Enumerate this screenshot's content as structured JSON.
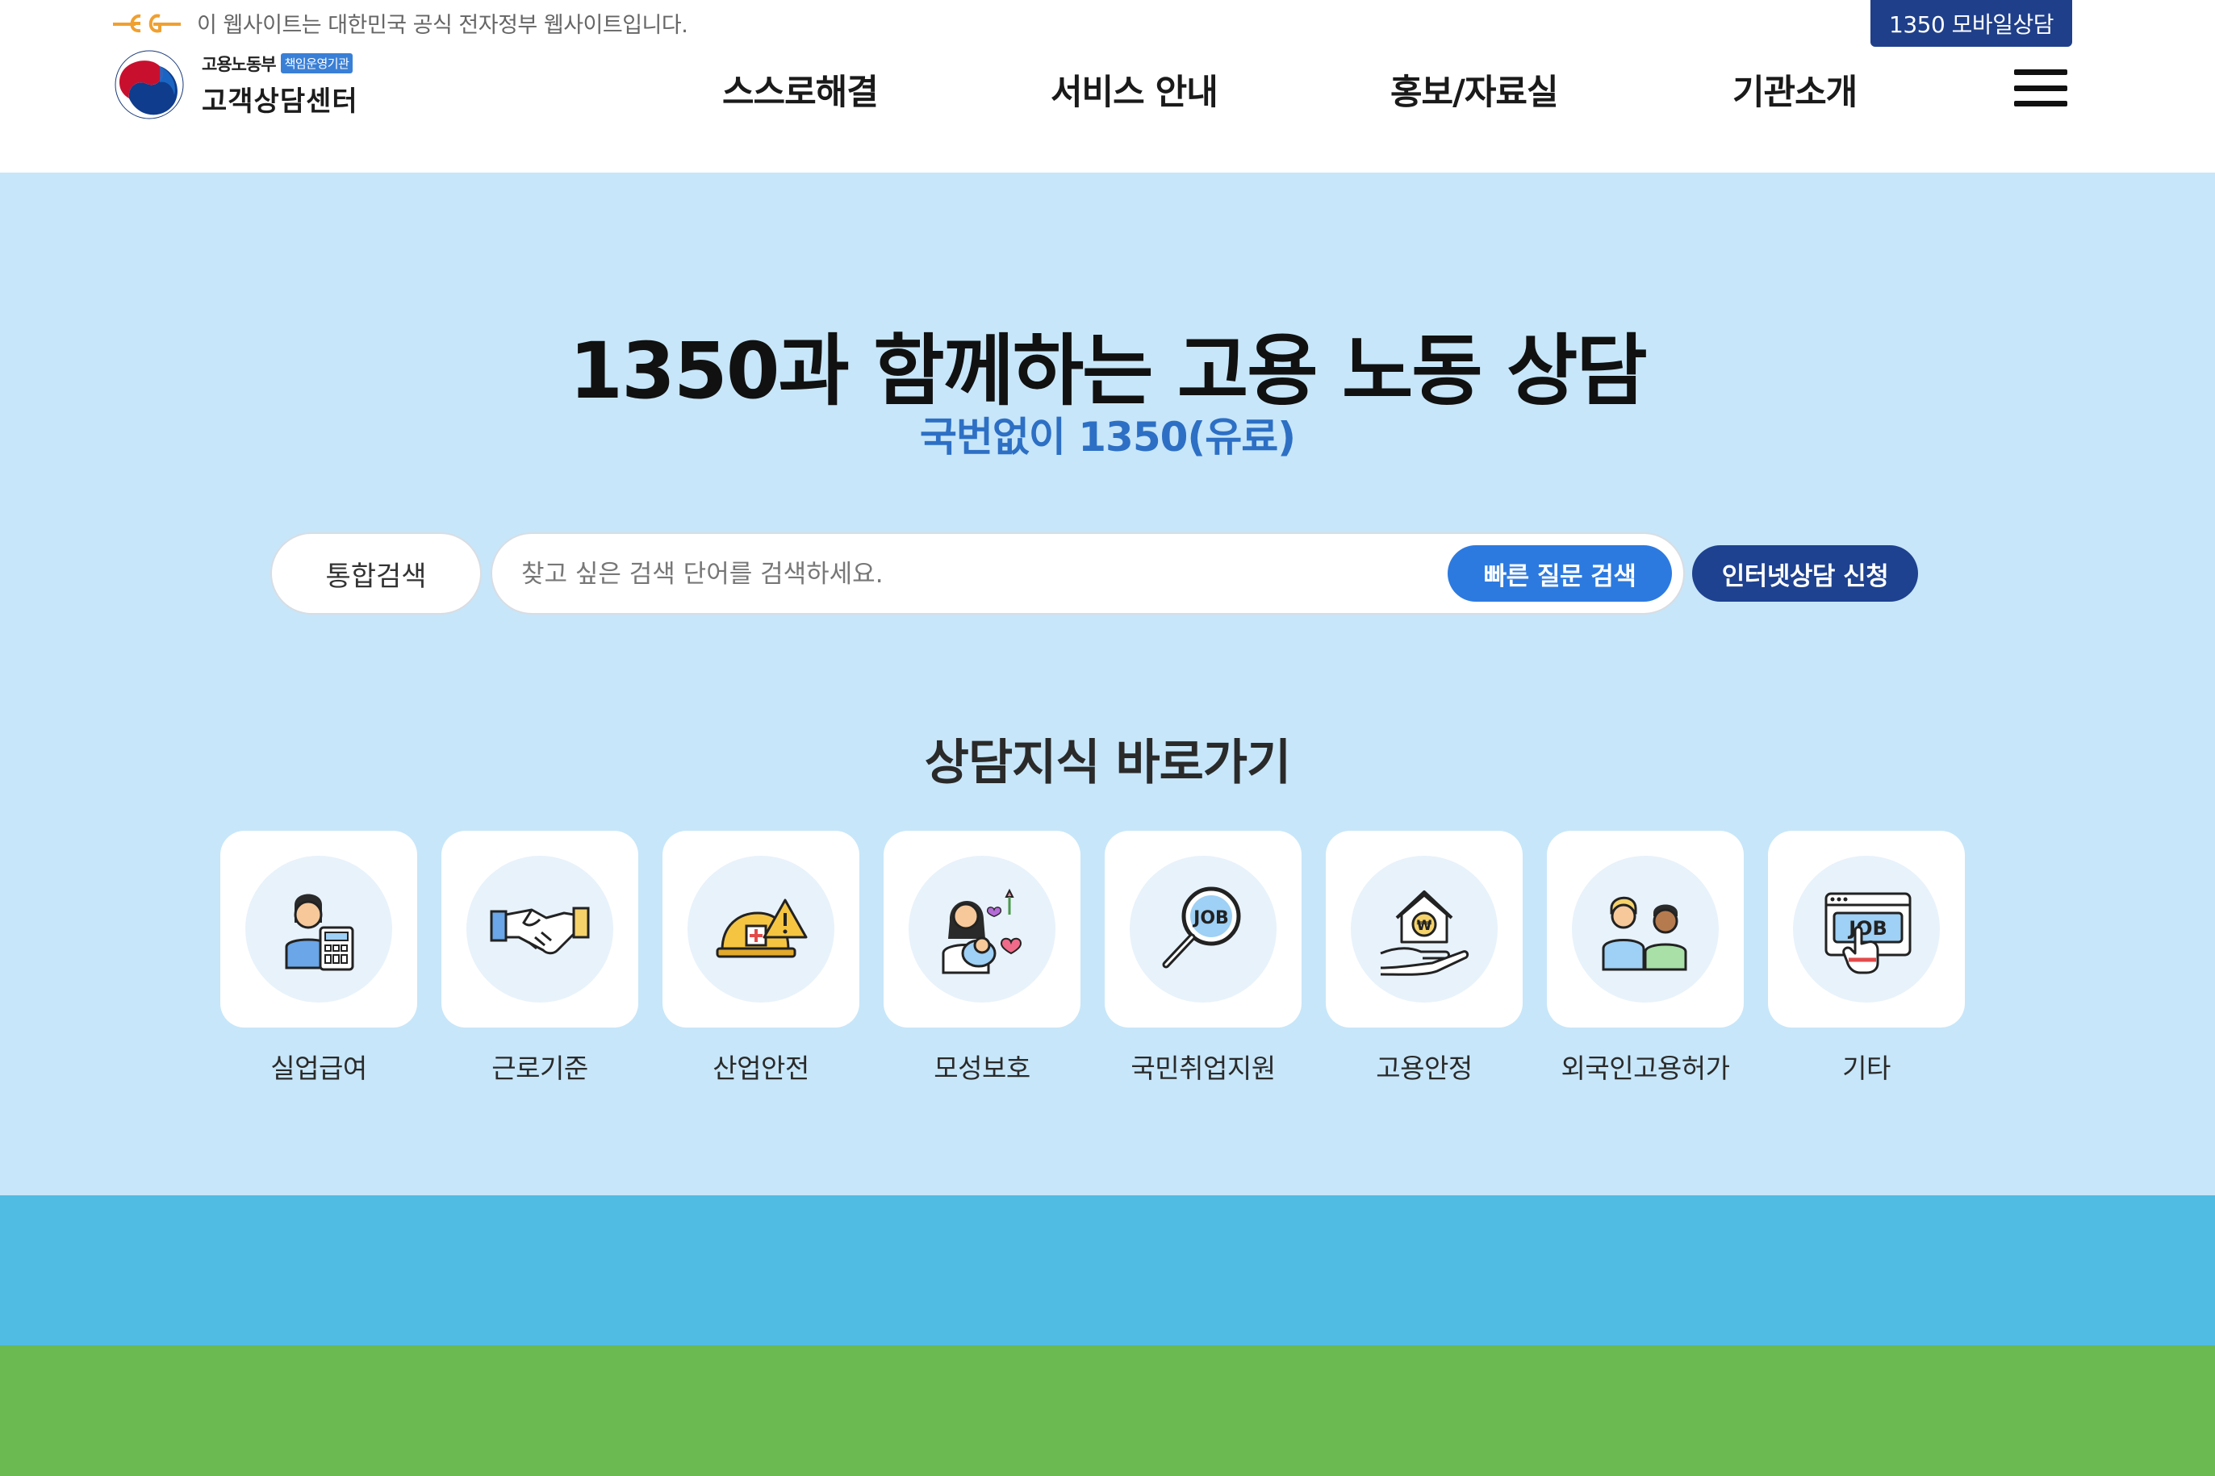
{
  "header": {
    "gov_notice": "이 웹사이트는 대한민국 공식 전자정부 웹사이트입니다.",
    "mobile_button": "1350 모바일상담",
    "logo": {
      "ministry": "고용노동부",
      "badge": "책임운영기관",
      "center_name": "고객상담센터"
    },
    "nav": [
      {
        "label": "스스로해결"
      },
      {
        "label": "서비스 안내"
      },
      {
        "label": "홍보/자료실"
      },
      {
        "label": "기관소개"
      }
    ],
    "menu_icon": "hamburger-menu-icon"
  },
  "hero": {
    "title": "1350과 함께하는 고용 노동 상담",
    "subtitle": "국번없이 1350(유료)",
    "search": {
      "category": "통합검색",
      "placeholder": "찾고 싶은 검색 단어를 검색하세요.",
      "value": "",
      "quick_button": "빠른 질문 검색",
      "online_button": "인터넷상담 신청"
    },
    "shortcuts_title": "상담지식 바로가기",
    "shortcuts": [
      {
        "label": "실업급여",
        "icon": "worker-calculator-icon"
      },
      {
        "label": "근로기준",
        "icon": "handshake-icon"
      },
      {
        "label": "산업안전",
        "icon": "safety-helmet-warning-icon"
      },
      {
        "label": "모성보호",
        "icon": "mother-baby-icon"
      },
      {
        "label": "국민취업지원",
        "icon": "job-search-magnifier-icon"
      },
      {
        "label": "고용안정",
        "icon": "house-won-hand-icon"
      },
      {
        "label": "외국인고용허가",
        "icon": "two-people-icon"
      },
      {
        "label": "기타",
        "icon": "job-browser-icon"
      }
    ]
  },
  "colors": {
    "hero_bg": "#c7e6f9",
    "accent_blue": "#2c7ae0",
    "navy": "#1e4190",
    "subtitle_blue": "#2d6fc4",
    "band_blue": "#50bce4",
    "band_green": "#6bb951"
  }
}
